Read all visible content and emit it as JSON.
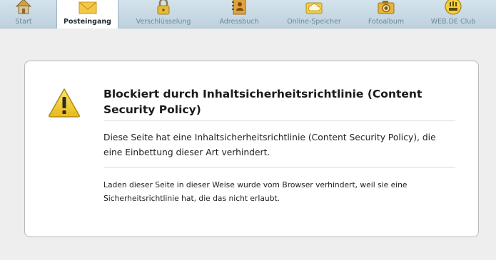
{
  "nav": {
    "items": [
      {
        "label": "Start",
        "icon": "house-icon",
        "active": false
      },
      {
        "label": "Posteingang",
        "icon": "envelope-icon",
        "active": true
      },
      {
        "label": "Verschlüsselung",
        "icon": "padlock-icon",
        "active": false
      },
      {
        "label": "Adressbuch",
        "icon": "address-book-icon",
        "active": false
      },
      {
        "label": "Online-Speicher",
        "icon": "cloud-folder-icon",
        "active": false
      },
      {
        "label": "Fotoalbum",
        "icon": "camera-icon",
        "active": false
      },
      {
        "label": "WEB.DE Club",
        "icon": "club-badge-icon",
        "active": false
      }
    ]
  },
  "error": {
    "icon": "warning-icon",
    "title": "Blockiert durch Inhaltsicherheitsrichtlinie (Content Security Policy)",
    "description": "Diese Seite hat eine Inhaltsicherheitsrichtlinie (Content Security Policy), die eine Einbettung dieser Art verhindert.",
    "detail": "Laden dieser Seite in dieser Weise wurde vom Browser verhindert, weil sie eine Sicherheitsrichtlinie hat, die das nicht erlaubt."
  },
  "colors": {
    "nav_background": "#c8dae5",
    "nav_label": "#6f8898",
    "page_background": "#eeeeee",
    "warning_yellow": "#f2d027"
  }
}
